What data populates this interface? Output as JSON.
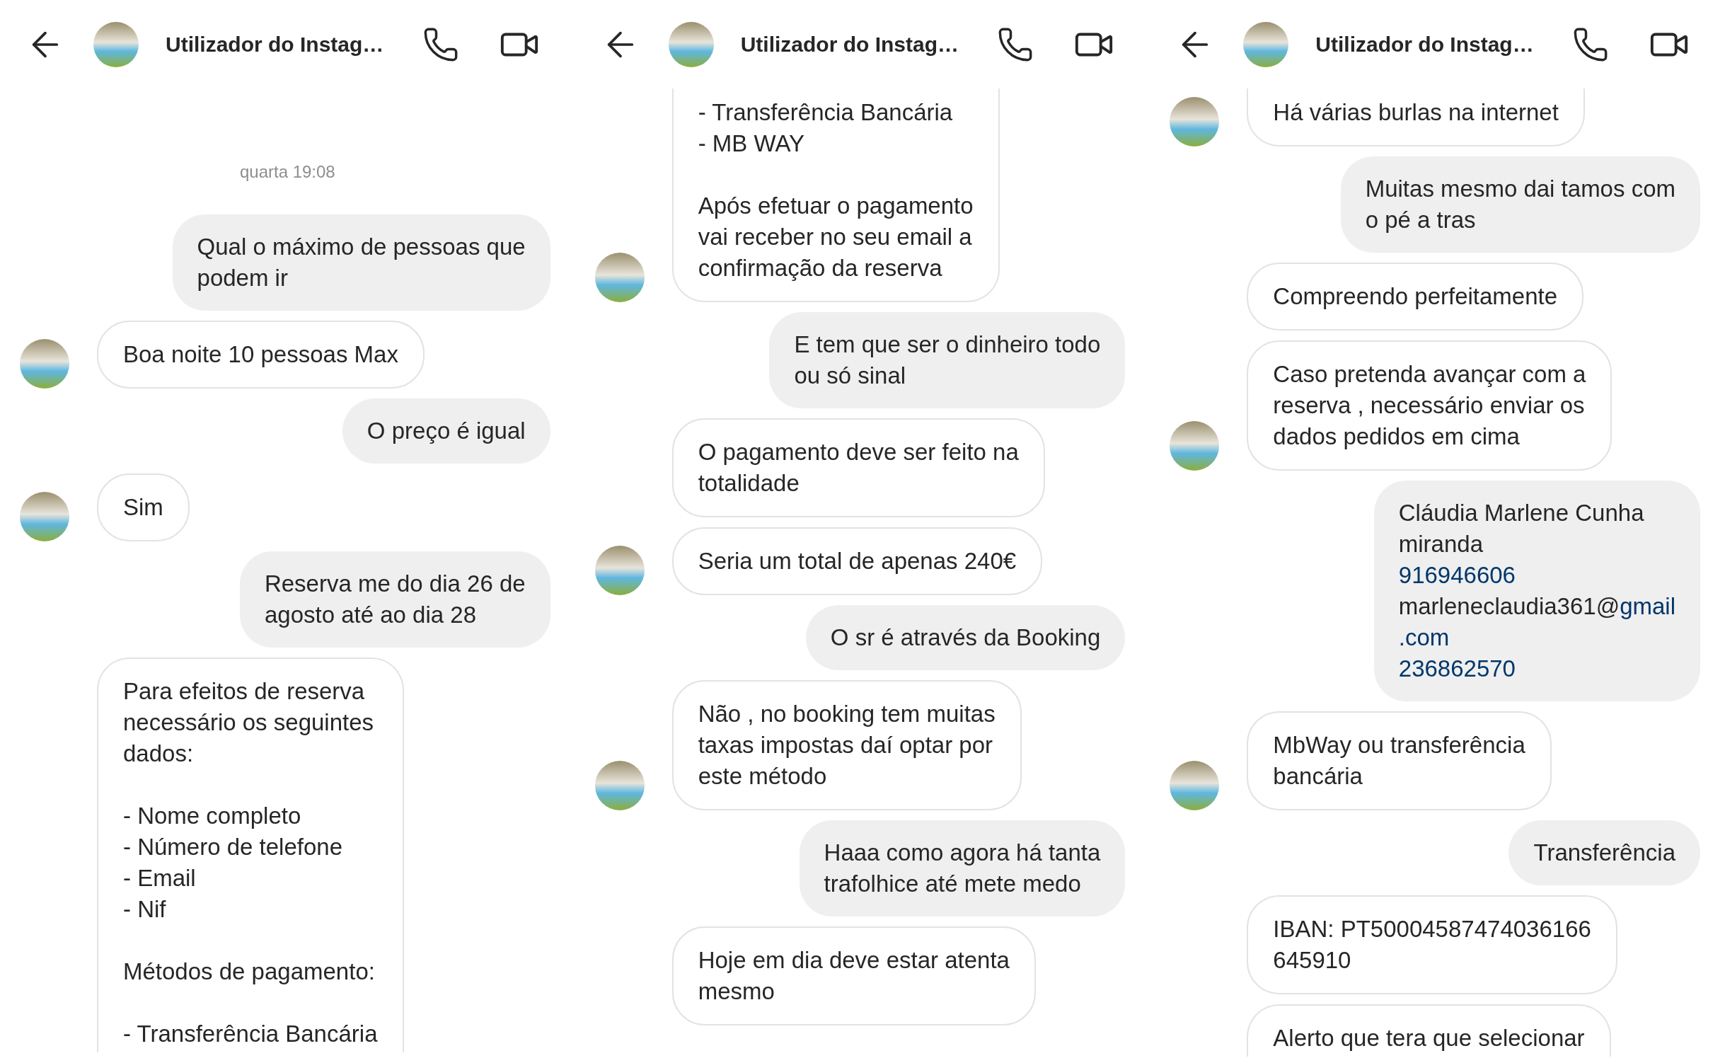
{
  "panels": [
    {
      "header": {
        "name": "Utilizador do Instag…"
      },
      "items": [
        {
          "kind": "timestamp",
          "text": "quarta 19:08"
        },
        {
          "kind": "sent",
          "text": "Qual o máximo de pessoas que\npodem ir"
        },
        {
          "kind": "received",
          "avatar": true,
          "text": "Boa noite 10 pessoas Max"
        },
        {
          "kind": "sent",
          "text": "O preço é igual"
        },
        {
          "kind": "received",
          "avatar": true,
          "text": "Sim"
        },
        {
          "kind": "sent",
          "text": "Reserva me do dia 26  de\nagosto até ao dia 28"
        },
        {
          "kind": "received",
          "avatar": false,
          "cut_bottom": true,
          "text": "Para efeitos de reserva\nnecessário os seguintes\ndados:\n\n- Nome completo\n- Número de telefone\n- Email\n- Nif\n\nMétodos de pagamento:\n\n- Transferência Bancária"
        }
      ]
    },
    {
      "header": {
        "name": "Utilizador do Instag…"
      },
      "items": [
        {
          "kind": "received",
          "avatar": true,
          "cut_top": true,
          "text": "- Transferência Bancária\n- MB WAY\n\nApós efetuar o pagamento\nvai receber no seu email a\nconfirmação da reserva"
        },
        {
          "kind": "sent",
          "text": "E tem que ser o dinheiro todo\nou só sinal"
        },
        {
          "kind": "received",
          "avatar": false,
          "text": "O pagamento deve ser feito na\ntotalidade"
        },
        {
          "kind": "received",
          "avatar": true,
          "text": "Seria um total de apenas 240€"
        },
        {
          "kind": "sent",
          "text": "O sr é através da Booking"
        },
        {
          "kind": "received",
          "avatar": true,
          "text": "Não , no booking tem muitas\ntaxas impostas daí optar por\neste método"
        },
        {
          "kind": "sent",
          "text": "Haaa como agora há tanta\ntrafolhice até mete medo"
        },
        {
          "kind": "received",
          "avatar": false,
          "text": "Hoje em dia deve estar atenta\nmesmo"
        }
      ]
    },
    {
      "header": {
        "name": "Utilizador do Instag…"
      },
      "items": [
        {
          "kind": "received",
          "avatar": true,
          "cut_top": true,
          "text": "Há várias burlas na internet"
        },
        {
          "kind": "sent",
          "text": "Muitas mesmo dai tamos com\no pé a tras"
        },
        {
          "kind": "received",
          "avatar": false,
          "text": "Compreendo perfeitamente"
        },
        {
          "kind": "received",
          "avatar": true,
          "text": "Caso pretenda avançar com a\nreserva , necessário enviar os\ndados pedidos em cima"
        },
        {
          "kind": "sent",
          "lines": [
            [
              {
                "text": "Cláudia Marlene Cunha",
                "link": false
              }
            ],
            [
              {
                "text": "miranda",
                "link": false
              }
            ],
            [
              {
                "text": "916946606",
                "link": true
              }
            ],
            [
              {
                "text": "marleneclaudia361@",
                "link": false
              },
              {
                "text": "gmail",
                "link": true
              }
            ],
            [
              {
                "text": ".com",
                "link": true
              }
            ],
            [
              {
                "text": "236862570",
                "link": true
              }
            ]
          ]
        },
        {
          "kind": "received",
          "avatar": true,
          "text": "MbWay ou transferência\nbancária"
        },
        {
          "kind": "sent",
          "text": "Transferência"
        },
        {
          "kind": "received",
          "avatar": false,
          "text": "IBAN: PT50004587474036166\n645910"
        },
        {
          "kind": "received",
          "avatar": false,
          "cut_bottom": true,
          "text": "Alerto que tera que selecionar"
        }
      ]
    }
  ]
}
